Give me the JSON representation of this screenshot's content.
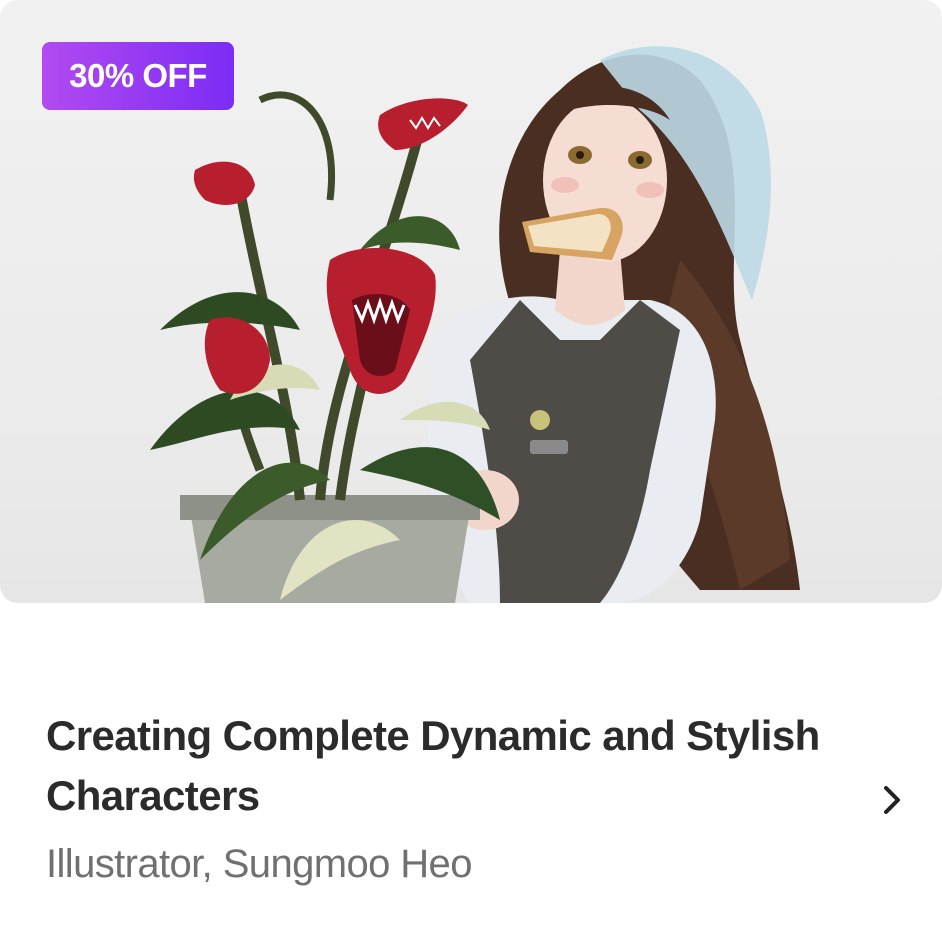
{
  "course_card": {
    "badge": "30% OFF",
    "title": "Creating Complete Dynamic and Stylish Characters",
    "instructor": "Illustrator, Sungmoo Heo",
    "thumbnail": "illustration of a girl with bread in her mouth holding a potted carnivorous plant",
    "badge_colors": [
      "#b24af0",
      "#7b2cf5"
    ],
    "arrow_icon": "chevron-right-icon"
  }
}
